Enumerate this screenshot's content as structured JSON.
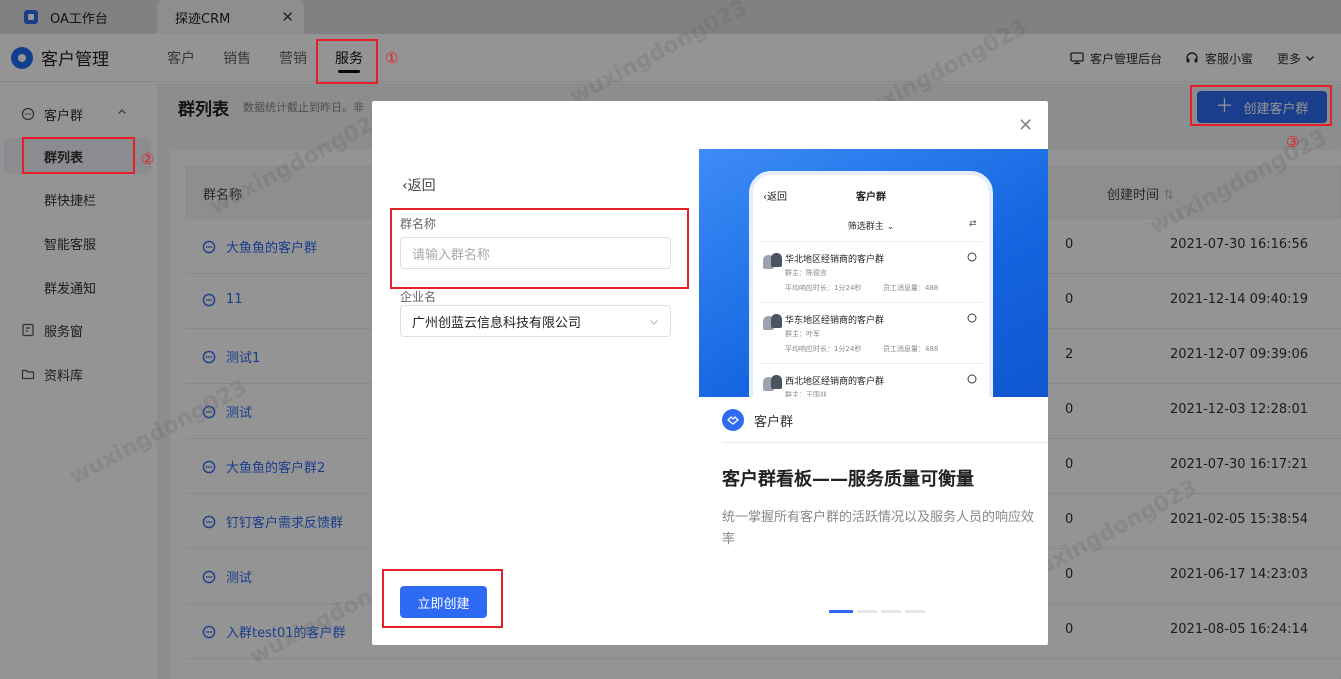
{
  "tabs": [
    {
      "label": "OA工作台"
    },
    {
      "label": "探迹CRM"
    }
  ],
  "header": {
    "brand": "客户管理",
    "nav": [
      "客户",
      "销售",
      "营销",
      "服务"
    ],
    "right": {
      "admin": "客户管理后台",
      "support": "客服小蜜",
      "more": "更多"
    }
  },
  "sidebar": {
    "group1": "客户群",
    "items": [
      "群列表",
      "群快捷栏",
      "智能客服",
      "群发通知"
    ],
    "group2": "服务窗",
    "group3": "资料库"
  },
  "main": {
    "title": "群列表",
    "subtitle": "数据统计截止到昨日。非",
    "create_button": "创建客户群",
    "columns": {
      "name": "群名称",
      "created": "创建时间"
    },
    "rows": [
      {
        "name": "大鱼鱼的客户群",
        "count": "0",
        "time": "2021-07-30 16:16:56"
      },
      {
        "name": "11",
        "count": "0",
        "time": "2021-12-14 09:40:19"
      },
      {
        "name": "测试1",
        "count": "2",
        "time": "2021-12-07 09:39:06"
      },
      {
        "name": "测试",
        "count": "0",
        "time": "2021-12-03 12:28:01"
      },
      {
        "name": "大鱼鱼的客户群2",
        "count": "0",
        "time": "2021-07-30 16:17:21"
      },
      {
        "name": "钉钉客户需求反馈群",
        "count": "0",
        "time": "2021-02-05 15:38:54"
      },
      {
        "name": "测试",
        "count": "0",
        "time": "2021-06-17 14:23:03"
      },
      {
        "name": "入群test01的客户群",
        "count": "0",
        "time": "2021-08-05 16:24:14"
      }
    ]
  },
  "modal": {
    "back": "返回",
    "group_name_label": "群名称",
    "group_name_placeholder": "请输入群名称",
    "company_label": "企业名",
    "company_value": "广州创蓝云信息科技有限公司",
    "submit": "立即创建",
    "promo": {
      "phone_back": "返回",
      "phone_title": "客户群",
      "phone_filter": "筛选群主",
      "phone_cards": [
        {
          "title": "华北地区经销商的客户群",
          "owner": "群主：陈德言",
          "m1": "平均响应时长：1分24秒",
          "m2": "员工消息量：488"
        },
        {
          "title": "华东地区经销商的客户群",
          "owner": "群主：叶军",
          "m1": "平均响应时长：1分24秒",
          "m2": "员工消息量：488"
        },
        {
          "title": "西北地区经销商的客户群",
          "owner": "群主：王国兆",
          "m1": "",
          "m2": ""
        }
      ],
      "brand": "客户群",
      "headline": "客户群看板——服务质量可衡量",
      "description": "统一掌握所有客户群的活跃情况以及服务人员的响应效率"
    }
  },
  "annotations": [
    "①",
    "②",
    "③"
  ],
  "watermark": "wuxingdong023"
}
